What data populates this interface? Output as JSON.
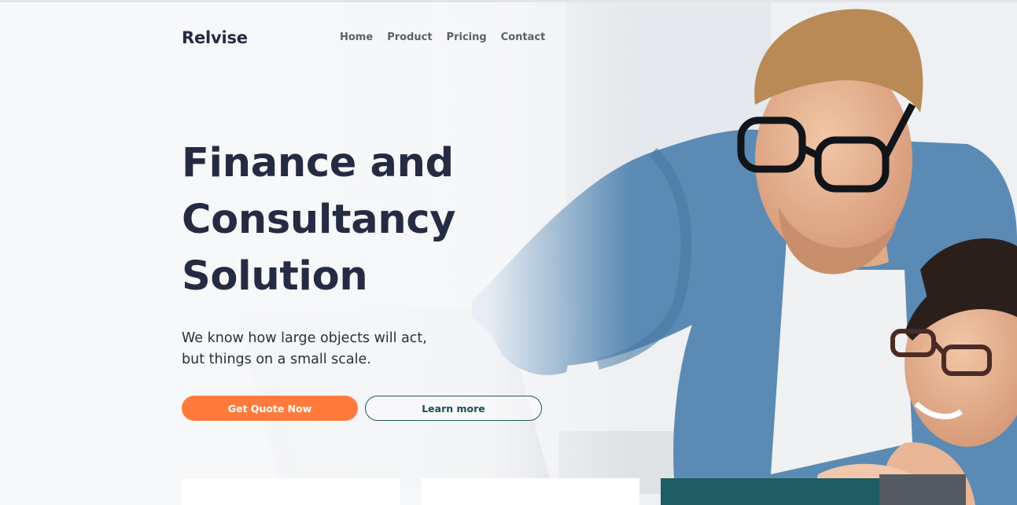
{
  "nav": {
    "logo": "Relvise",
    "links": [
      "Home",
      "Product",
      "Pricing",
      "Contact"
    ]
  },
  "hero": {
    "headline_lines": [
      "Finance and",
      "Consultancy",
      "Solution"
    ],
    "subtext_lines": [
      "We know how large objects will act,",
      "but things on a small scale."
    ],
    "primary_button": "Get Quote Now",
    "secondary_button": "Learn more"
  },
  "colors": {
    "brand_text": "#252b42",
    "primary_button": "#ff7b3d",
    "secondary_border": "#23565e",
    "card_dark": "#1d5d63"
  },
  "icons": [
    "hero-photo"
  ]
}
